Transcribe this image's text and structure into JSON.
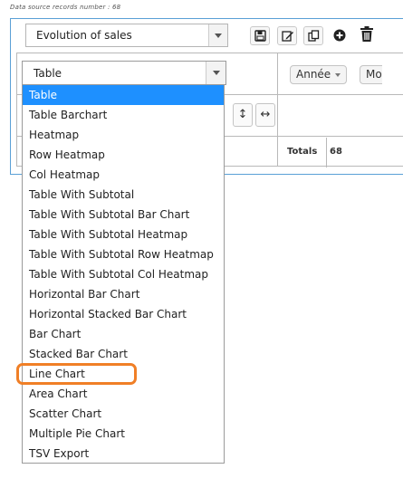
{
  "header": {
    "records_text": "Data source records number : 68"
  },
  "config_select": {
    "value": "Evolution of sales"
  },
  "toolbar": {
    "icons": [
      "save-icon",
      "edit-icon",
      "copy-icon",
      "add-circle-icon",
      "trash-icon"
    ]
  },
  "renderer_select": {
    "value": "Table",
    "options": [
      "Table",
      "Table Barchart",
      "Heatmap",
      "Row Heatmap",
      "Col Heatmap",
      "Table With Subtotal",
      "Table With Subtotal Bar Chart",
      "Table With Subtotal Heatmap",
      "Table With Subtotal Row Heatmap",
      "Table With Subtotal Col Heatmap",
      "Horizontal Bar Chart",
      "Horizontal Stacked Bar Chart",
      "Bar Chart",
      "Stacked Bar Chart",
      "Line Chart",
      "Area Chart",
      "Scatter Chart",
      "Multiple Pie Chart",
      "TSV Export"
    ],
    "selected_index": 0,
    "highlighted_index": 14
  },
  "attributes": [
    "Année",
    "Mo"
  ],
  "sort_buttons": {
    "vertical": "↕",
    "horizontal": "↔"
  },
  "totals": {
    "label": "Totals",
    "value": "68"
  },
  "colors": {
    "panel_border": "#5aa0d6",
    "selected_option": "#1e90ff",
    "highlight_ring": "#f07f26"
  }
}
